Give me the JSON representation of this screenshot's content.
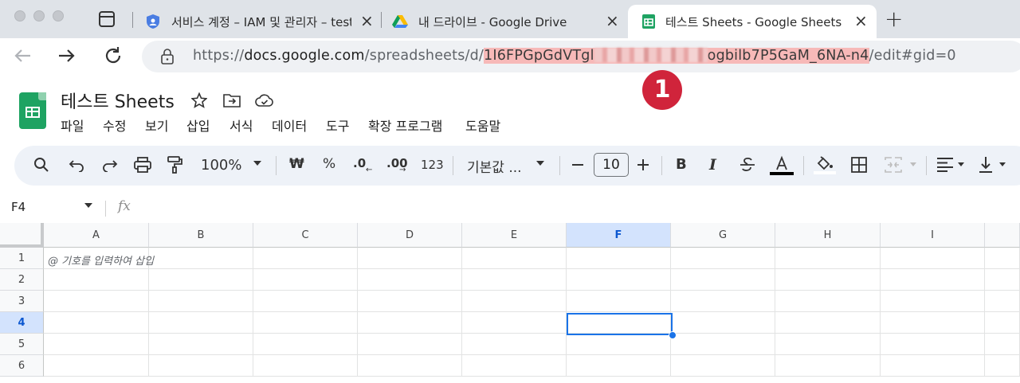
{
  "browser": {
    "tabs": [
      {
        "title": "서비스 계정 – IAM 및 관리자 – test",
        "favicon": "iam-shield-icon",
        "active": false
      },
      {
        "title": "내 드라이브 - Google Drive",
        "favicon": "google-drive-icon",
        "active": false
      },
      {
        "title": "테스트 Sheets - Google Sheets",
        "favicon": "google-sheets-icon",
        "active": true
      }
    ],
    "close_glyph": "×",
    "new_tab_glyph": "+",
    "address": {
      "prefix": "https://",
      "host": "docs.google.com",
      "path_before": "/spreadsheets/d/",
      "id_start": "1I6FPGpGdVTgl",
      "id_end": "ogbilb7P5GaM_6NA-n4",
      "path_after": "/edit#gid=0"
    },
    "annotation_badge": "1",
    "accent_colors": {
      "highlight": "#f7b9b8",
      "badge": "#d0243b",
      "sheets_green": "#1ea362",
      "selection_blue": "#1a73e8"
    }
  },
  "sheets": {
    "title": "테스트 Sheets",
    "menu": [
      "파일",
      "수정",
      "보기",
      "삽입",
      "서식",
      "데이터",
      "도구",
      "확장 프로그램",
      "도움말"
    ],
    "toolbar": {
      "zoom": "100%",
      "currency": "₩",
      "percent": "%",
      "dec_decrease": ".0",
      "dec_increase": ".00",
      "number_format": "123",
      "font": "기본값 ...",
      "font_size": "10"
    },
    "name_box": "F4",
    "fx": "fx",
    "columns": [
      "A",
      "B",
      "C",
      "D",
      "E",
      "F",
      "G",
      "H",
      "I"
    ],
    "rows": [
      "1",
      "2",
      "3",
      "4",
      "5",
      "6"
    ],
    "selected_cell": "F4",
    "a1_hint": "@ 기호를 입력하여 삽입"
  }
}
